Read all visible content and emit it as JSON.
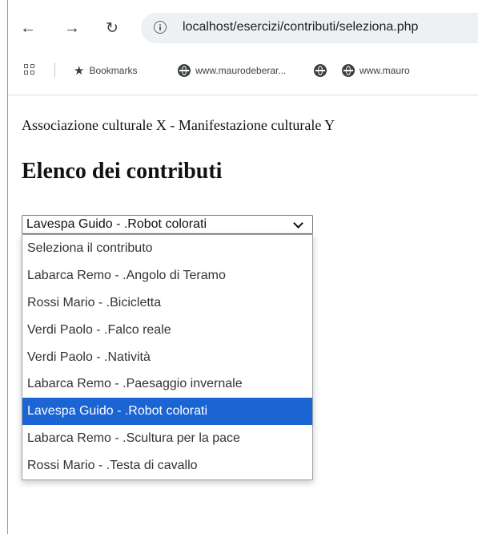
{
  "browser": {
    "url": "localhost/esercizi/contributi/seleziona.php",
    "bookmarks_label": "Bookmarks",
    "bookmarks": [
      "www.maurodeberar...",
      "",
      "www.mauro"
    ]
  },
  "page": {
    "subtitle": "Associazione culturale X - Manifestazione culturale Y",
    "heading": "Elenco dei contributi"
  },
  "select": {
    "value": "Lavespa Guido - .Robot colorati",
    "selected_index": 6,
    "options": [
      "Seleziona il contributo",
      "Labarca Remo - .Angolo di Teramo",
      "Rossi Mario - .Bicicletta",
      "Verdi Paolo - .Falco reale",
      "Verdi Paolo - .Natività",
      "Labarca Remo - .Paesaggio invernale",
      "Lavespa Guido - .Robot colorati",
      "Labarca Remo - .Scultura per la pace",
      "Rossi Mario - .Testa di cavallo"
    ]
  },
  "colors": {
    "selected_bg": "#1a64d4",
    "selected_text": "#ffffff"
  },
  "icons": [
    "back-icon",
    "forward-icon",
    "reload-icon",
    "info-icon",
    "apps-icon",
    "star-icon",
    "globe-icon",
    "chevron-down-icon"
  ]
}
